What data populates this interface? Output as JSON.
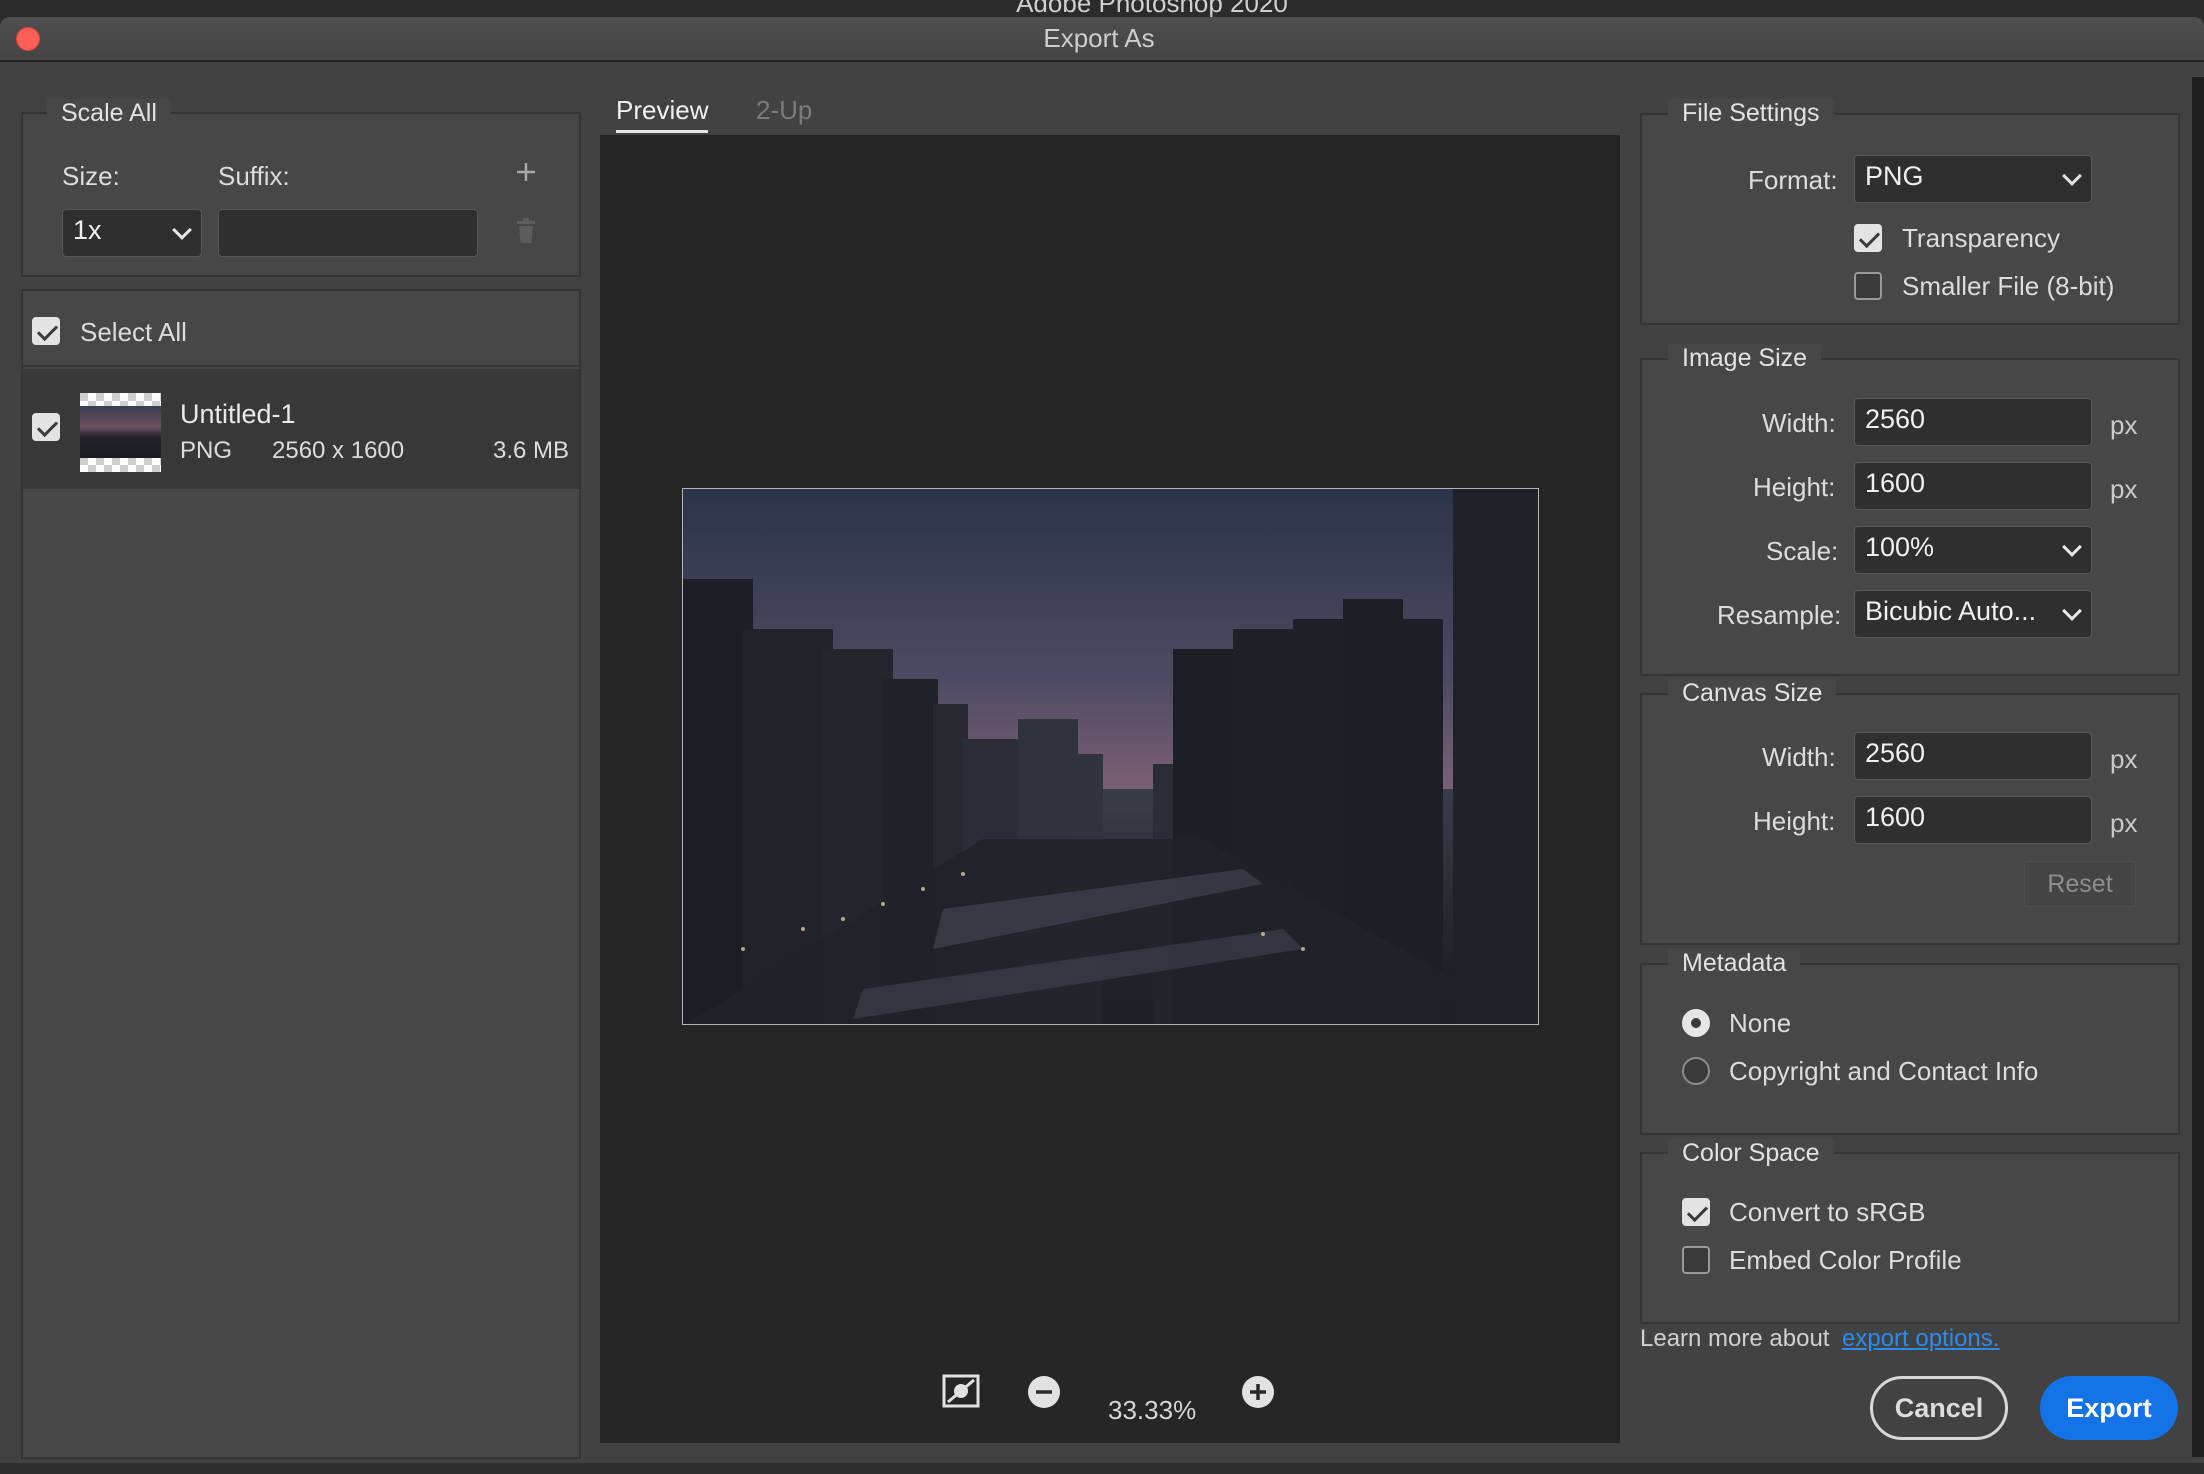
{
  "app": {
    "title": "Adobe Photoshop 2020"
  },
  "dialog": {
    "title": "Export As"
  },
  "scale_all": {
    "legend": "Scale All",
    "size_label": "Size:",
    "suffix_label": "Suffix:",
    "size_value": "1x",
    "suffix_value": "",
    "add_icon": "plus-icon",
    "delete_icon": "trash-icon"
  },
  "assets": {
    "select_all_label": "Select All",
    "select_all_checked": true,
    "items": [
      {
        "name": "Untitled-1",
        "format": "PNG",
        "dimensions": "2560 x 1600",
        "size": "3.6 MB",
        "checked": true
      }
    ]
  },
  "preview": {
    "tabs": [
      {
        "label": "Preview",
        "active": true
      },
      {
        "label": "2-Up",
        "active": false
      }
    ],
    "zoom": "33.33%",
    "icons": [
      "background-toggle-icon",
      "zoom-out-icon",
      "zoom-in-icon"
    ]
  },
  "file_settings": {
    "legend": "File Settings",
    "format_label": "Format:",
    "format_value": "PNG",
    "transparency_label": "Transparency",
    "transparency_checked": true,
    "smaller_file_label": "Smaller File (8-bit)",
    "smaller_file_checked": false
  },
  "image_size": {
    "legend": "Image Size",
    "width_label": "Width:",
    "width_value": "2560",
    "height_label": "Height:",
    "height_value": "1600",
    "scale_label": "Scale:",
    "scale_value": "100%",
    "resample_label": "Resample:",
    "resample_value": "Bicubic Auto...",
    "unit": "px"
  },
  "canvas_size": {
    "legend": "Canvas Size",
    "width_label": "Width:",
    "width_value": "2560",
    "height_label": "Height:",
    "height_value": "1600",
    "unit": "px",
    "reset_label": "Reset"
  },
  "metadata": {
    "legend": "Metadata",
    "options": [
      {
        "label": "None",
        "selected": true
      },
      {
        "label": "Copyright and Contact Info",
        "selected": false
      }
    ]
  },
  "color_space": {
    "legend": "Color Space",
    "convert_label": "Convert to sRGB",
    "convert_checked": true,
    "embed_label": "Embed Color Profile",
    "embed_checked": false
  },
  "footer": {
    "learn_more": "Learn more about",
    "link_text": "export options.",
    "cancel_label": "Cancel",
    "export_label": "Export"
  },
  "colors": {
    "accent": "#1473e6",
    "link": "#2d8ceb",
    "close": "#fe5f57"
  }
}
